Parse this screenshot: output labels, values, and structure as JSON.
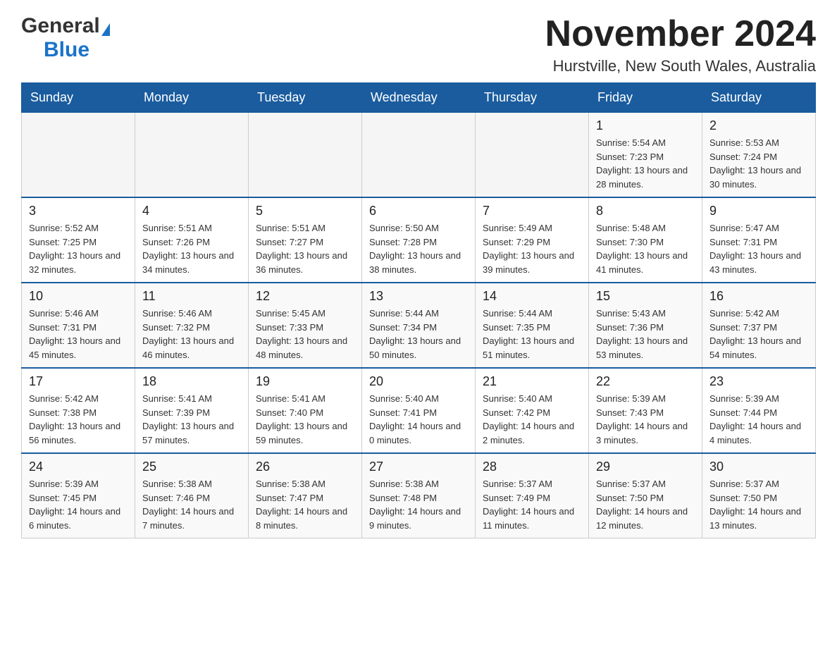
{
  "header": {
    "logo_general": "General",
    "logo_blue": "Blue",
    "month_title": "November 2024",
    "location": "Hurstville, New South Wales, Australia"
  },
  "days_of_week": [
    "Sunday",
    "Monday",
    "Tuesday",
    "Wednesday",
    "Thursday",
    "Friday",
    "Saturday"
  ],
  "weeks": [
    [
      {
        "day": "",
        "info": ""
      },
      {
        "day": "",
        "info": ""
      },
      {
        "day": "",
        "info": ""
      },
      {
        "day": "",
        "info": ""
      },
      {
        "day": "",
        "info": ""
      },
      {
        "day": "1",
        "info": "Sunrise: 5:54 AM\nSunset: 7:23 PM\nDaylight: 13 hours and 28 minutes."
      },
      {
        "day": "2",
        "info": "Sunrise: 5:53 AM\nSunset: 7:24 PM\nDaylight: 13 hours and 30 minutes."
      }
    ],
    [
      {
        "day": "3",
        "info": "Sunrise: 5:52 AM\nSunset: 7:25 PM\nDaylight: 13 hours and 32 minutes."
      },
      {
        "day": "4",
        "info": "Sunrise: 5:51 AM\nSunset: 7:26 PM\nDaylight: 13 hours and 34 minutes."
      },
      {
        "day": "5",
        "info": "Sunrise: 5:51 AM\nSunset: 7:27 PM\nDaylight: 13 hours and 36 minutes."
      },
      {
        "day": "6",
        "info": "Sunrise: 5:50 AM\nSunset: 7:28 PM\nDaylight: 13 hours and 38 minutes."
      },
      {
        "day": "7",
        "info": "Sunrise: 5:49 AM\nSunset: 7:29 PM\nDaylight: 13 hours and 39 minutes."
      },
      {
        "day": "8",
        "info": "Sunrise: 5:48 AM\nSunset: 7:30 PM\nDaylight: 13 hours and 41 minutes."
      },
      {
        "day": "9",
        "info": "Sunrise: 5:47 AM\nSunset: 7:31 PM\nDaylight: 13 hours and 43 minutes."
      }
    ],
    [
      {
        "day": "10",
        "info": "Sunrise: 5:46 AM\nSunset: 7:31 PM\nDaylight: 13 hours and 45 minutes."
      },
      {
        "day": "11",
        "info": "Sunrise: 5:46 AM\nSunset: 7:32 PM\nDaylight: 13 hours and 46 minutes."
      },
      {
        "day": "12",
        "info": "Sunrise: 5:45 AM\nSunset: 7:33 PM\nDaylight: 13 hours and 48 minutes."
      },
      {
        "day": "13",
        "info": "Sunrise: 5:44 AM\nSunset: 7:34 PM\nDaylight: 13 hours and 50 minutes."
      },
      {
        "day": "14",
        "info": "Sunrise: 5:44 AM\nSunset: 7:35 PM\nDaylight: 13 hours and 51 minutes."
      },
      {
        "day": "15",
        "info": "Sunrise: 5:43 AM\nSunset: 7:36 PM\nDaylight: 13 hours and 53 minutes."
      },
      {
        "day": "16",
        "info": "Sunrise: 5:42 AM\nSunset: 7:37 PM\nDaylight: 13 hours and 54 minutes."
      }
    ],
    [
      {
        "day": "17",
        "info": "Sunrise: 5:42 AM\nSunset: 7:38 PM\nDaylight: 13 hours and 56 minutes."
      },
      {
        "day": "18",
        "info": "Sunrise: 5:41 AM\nSunset: 7:39 PM\nDaylight: 13 hours and 57 minutes."
      },
      {
        "day": "19",
        "info": "Sunrise: 5:41 AM\nSunset: 7:40 PM\nDaylight: 13 hours and 59 minutes."
      },
      {
        "day": "20",
        "info": "Sunrise: 5:40 AM\nSunset: 7:41 PM\nDaylight: 14 hours and 0 minutes."
      },
      {
        "day": "21",
        "info": "Sunrise: 5:40 AM\nSunset: 7:42 PM\nDaylight: 14 hours and 2 minutes."
      },
      {
        "day": "22",
        "info": "Sunrise: 5:39 AM\nSunset: 7:43 PM\nDaylight: 14 hours and 3 minutes."
      },
      {
        "day": "23",
        "info": "Sunrise: 5:39 AM\nSunset: 7:44 PM\nDaylight: 14 hours and 4 minutes."
      }
    ],
    [
      {
        "day": "24",
        "info": "Sunrise: 5:39 AM\nSunset: 7:45 PM\nDaylight: 14 hours and 6 minutes."
      },
      {
        "day": "25",
        "info": "Sunrise: 5:38 AM\nSunset: 7:46 PM\nDaylight: 14 hours and 7 minutes."
      },
      {
        "day": "26",
        "info": "Sunrise: 5:38 AM\nSunset: 7:47 PM\nDaylight: 14 hours and 8 minutes."
      },
      {
        "day": "27",
        "info": "Sunrise: 5:38 AM\nSunset: 7:48 PM\nDaylight: 14 hours and 9 minutes."
      },
      {
        "day": "28",
        "info": "Sunrise: 5:37 AM\nSunset: 7:49 PM\nDaylight: 14 hours and 11 minutes."
      },
      {
        "day": "29",
        "info": "Sunrise: 5:37 AM\nSunset: 7:50 PM\nDaylight: 14 hours and 12 minutes."
      },
      {
        "day": "30",
        "info": "Sunrise: 5:37 AM\nSunset: 7:50 PM\nDaylight: 14 hours and 13 minutes."
      }
    ]
  ]
}
